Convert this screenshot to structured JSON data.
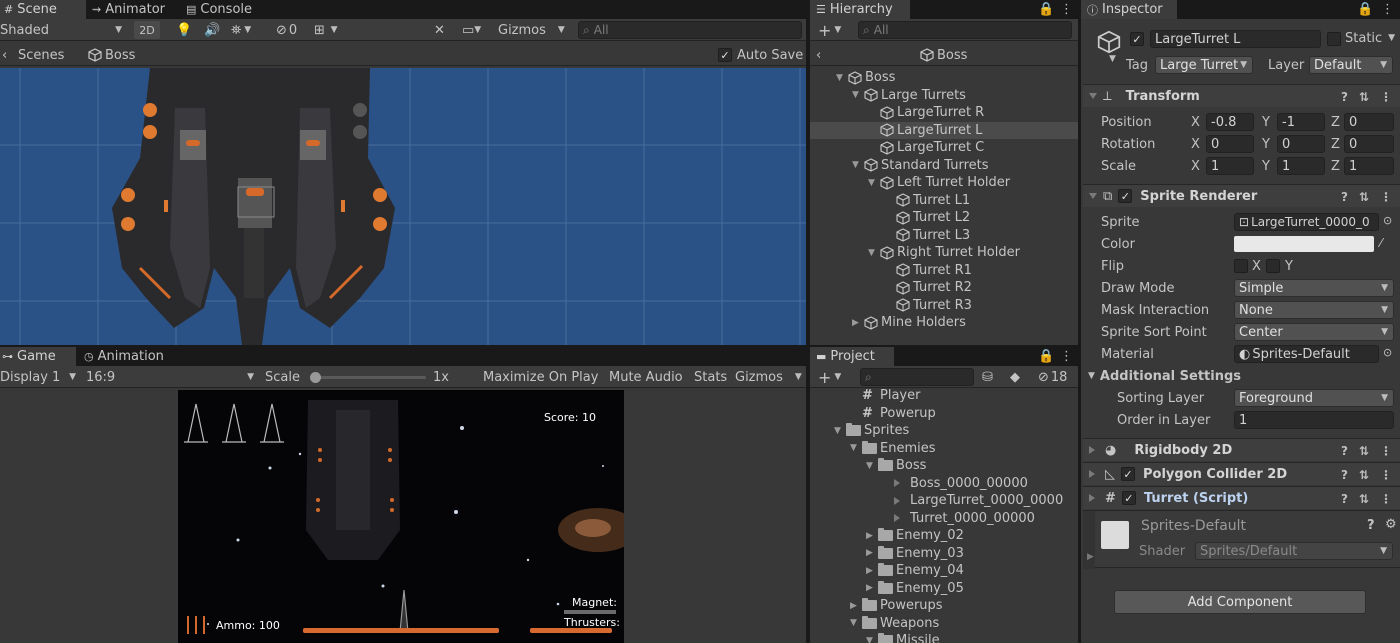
{
  "scene_view": {
    "tabs": [
      "Scene",
      "Animator",
      "Console"
    ],
    "shading_mode": "Shaded",
    "mode_2d_label": "2D",
    "hidden_count": "0",
    "gizmos_label": "Gizmos",
    "search_placeholder": "All",
    "breadcrumb_root": "Scenes",
    "breadcrumb_current": "Boss",
    "auto_save_label": "Auto Save",
    "background_color": "#2b5286"
  },
  "hierarchy": {
    "tab_label": "Hierarchy",
    "search_placeholder": "All",
    "prefab_title": "Boss",
    "items": [
      {
        "label": "Boss",
        "depth": 0,
        "expanded": true,
        "selected": false
      },
      {
        "label": "Large Turrets",
        "depth": 1,
        "expanded": true,
        "selected": false
      },
      {
        "label": "LargeTurret R",
        "depth": 2,
        "expanded": false,
        "selected": false
      },
      {
        "label": "LargeTurret L",
        "depth": 2,
        "expanded": false,
        "selected": true
      },
      {
        "label": "LargeTurret C",
        "depth": 2,
        "expanded": false,
        "selected": false
      },
      {
        "label": "Standard Turrets",
        "depth": 1,
        "expanded": true,
        "selected": false
      },
      {
        "label": "Left Turret Holder",
        "depth": 2,
        "expanded": true,
        "selected": false
      },
      {
        "label": "Turret L1",
        "depth": 3,
        "expanded": false,
        "selected": false
      },
      {
        "label": "Turret L2",
        "depth": 3,
        "expanded": false,
        "selected": false
      },
      {
        "label": "Turret L3",
        "depth": 3,
        "expanded": false,
        "selected": false
      },
      {
        "label": "Right Turret Holder",
        "depth": 2,
        "expanded": true,
        "selected": false
      },
      {
        "label": "Turret R1",
        "depth": 3,
        "expanded": false,
        "selected": false
      },
      {
        "label": "Turret R2",
        "depth": 3,
        "expanded": false,
        "selected": false
      },
      {
        "label": "Turret R3",
        "depth": 3,
        "expanded": false,
        "selected": false
      },
      {
        "label": "Mine Holders",
        "depth": 1,
        "expanded": false,
        "selected": false
      }
    ]
  },
  "game_view": {
    "tabs": [
      "Game",
      "Animation"
    ],
    "display": "Display 1",
    "aspect": "16:9",
    "scale_label": "Scale",
    "scale_value": "1x",
    "maximize_label": "Maximize On Play",
    "mute_label": "Mute Audio",
    "stats_label": "Stats",
    "gizmos_label": "Gizmos",
    "score_text": "Score: 10",
    "ammo_text": "Ammo: 100",
    "magnet_text": "Magnet:",
    "thrusters_text": "Thrusters:",
    "ammo_bar_fraction": 1.0,
    "thrusters_bar_fraction": 1.0
  },
  "project": {
    "tab_label": "Project",
    "hidden_count": "18",
    "items": [
      {
        "label": "Player",
        "type": "script",
        "depth": 2
      },
      {
        "label": "Powerup",
        "type": "script",
        "depth": 2
      },
      {
        "label": "Sprites",
        "type": "folder",
        "depth": 1,
        "expanded": true
      },
      {
        "label": "Enemies",
        "type": "folder",
        "depth": 2,
        "expanded": true
      },
      {
        "label": "Boss",
        "type": "folder",
        "depth": 3,
        "expanded": true
      },
      {
        "label": "Boss_0000_00000",
        "type": "sprite",
        "depth": 4
      },
      {
        "label": "LargeTurret_0000_0000",
        "type": "sprite",
        "depth": 4
      },
      {
        "label": "Turret_0000_00000",
        "type": "sprite",
        "depth": 4
      },
      {
        "label": "Enemy_02",
        "type": "folder",
        "depth": 3,
        "expanded": false
      },
      {
        "label": "Enemy_03",
        "type": "folder",
        "depth": 3,
        "expanded": false
      },
      {
        "label": "Enemy_04",
        "type": "folder",
        "depth": 3,
        "expanded": false
      },
      {
        "label": "Enemy_05",
        "type": "folder",
        "depth": 3,
        "expanded": false
      },
      {
        "label": "Powerups",
        "type": "folder",
        "depth": 2,
        "expanded": false
      },
      {
        "label": "Weapons",
        "type": "folder",
        "depth": 2,
        "expanded": true
      },
      {
        "label": "Missile",
        "type": "folder",
        "depth": 3,
        "expanded": true
      }
    ]
  },
  "inspector": {
    "tab_label": "Inspector",
    "object_name": "LargeTurret L",
    "static_label": "Static",
    "tag_label": "Tag",
    "tag_value": "Large Turret",
    "layer_label": "Layer",
    "layer_value": "Default",
    "transform": {
      "title": "Transform",
      "position_label": "Position",
      "rotation_label": "Rotation",
      "scale_label": "Scale",
      "position": {
        "x": "-0.8",
        "y": "-1",
        "z": "0"
      },
      "rotation": {
        "x": "0",
        "y": "0",
        "z": "0"
      },
      "scale": {
        "x": "1",
        "y": "1",
        "z": "1"
      }
    },
    "sprite_renderer": {
      "title": "Sprite Renderer",
      "sprite_label": "Sprite",
      "sprite_value": "LargeTurret_0000_0",
      "color_label": "Color",
      "color_value": "#e8e8e8",
      "flip_label": "Flip",
      "draw_mode_label": "Draw Mode",
      "draw_mode_value": "Simple",
      "mask_label": "Mask Interaction",
      "mask_value": "None",
      "sort_point_label": "Sprite Sort Point",
      "sort_point_value": "Center",
      "material_label": "Material",
      "material_value": "Sprites-Default",
      "additional_label": "Additional Settings",
      "sorting_layer_label": "Sorting Layer",
      "sorting_layer_value": "Foreground",
      "order_label": "Order in Layer",
      "order_value": "1"
    },
    "rigidbody_title": "Rigidbody 2D",
    "collider_title": "Polygon Collider 2D",
    "script_title": "Turret (Script)",
    "material_preview": {
      "name": "Sprites-Default",
      "shader_label": "Shader",
      "shader_value": "Sprites/Default"
    },
    "add_component_label": "Add Component"
  }
}
